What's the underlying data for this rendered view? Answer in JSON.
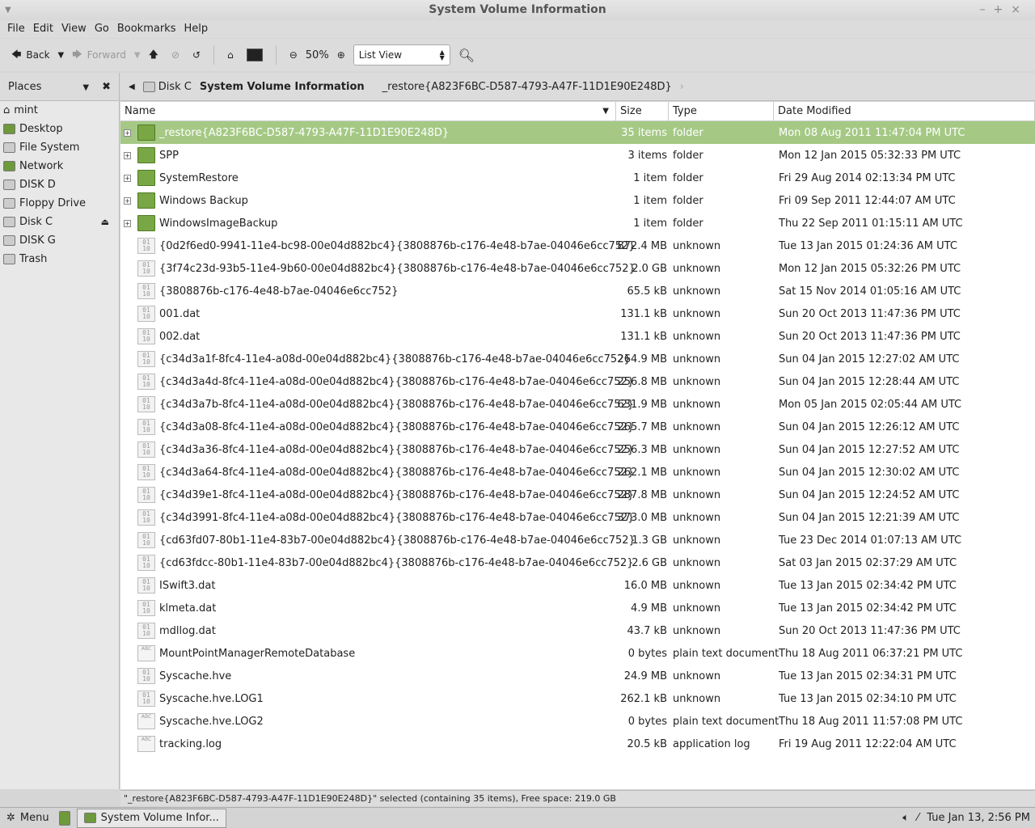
{
  "window": {
    "title": "System Volume Information"
  },
  "menu": [
    "File",
    "Edit",
    "View",
    "Go",
    "Bookmarks",
    "Help"
  ],
  "toolbar": {
    "back": "Back",
    "forward": "Forward",
    "zoom": "50%",
    "view_mode": "List View"
  },
  "sidebar": {
    "title": "Places",
    "items": [
      {
        "label": "mint",
        "icon": "home-icon"
      },
      {
        "label": "Desktop",
        "icon": "desktop-icon"
      },
      {
        "label": "File System",
        "icon": "drive-icon"
      },
      {
        "label": "Network",
        "icon": "network-icon"
      },
      {
        "label": "DISK D",
        "icon": "drive-icon"
      },
      {
        "label": "Floppy Drive",
        "icon": "floppy-icon"
      },
      {
        "label": "Disk C",
        "icon": "drive-icon"
      },
      {
        "label": "DISK G",
        "icon": "drive-icon"
      },
      {
        "label": "Trash",
        "icon": "trash-icon"
      }
    ]
  },
  "path": {
    "disk": "Disk C",
    "current": "System Volume Information",
    "child": "_restore{A823F6BC-D587-4793-A47F-11D1E90E248D}"
  },
  "columns": {
    "name": "Name",
    "size": "Size",
    "type": "Type",
    "date": "Date Modified"
  },
  "files": [
    {
      "name": "_restore{A823F6BC-D587-4793-A47F-11D1E90E248D}",
      "size": "35 items",
      "type": "folder",
      "date": "Mon 08 Aug 2011 11:47:04 PM UTC",
      "kind": "folder",
      "selected": true
    },
    {
      "name": "SPP",
      "size": "3 items",
      "type": "folder",
      "date": "Mon 12 Jan 2015 05:32:33 PM UTC",
      "kind": "folder"
    },
    {
      "name": "SystemRestore",
      "size": "1 item",
      "type": "folder",
      "date": "Fri 29 Aug 2014 02:13:34 PM UTC",
      "kind": "folder"
    },
    {
      "name": "Windows Backup",
      "size": "1 item",
      "type": "folder",
      "date": "Fri 09 Sep 2011 12:44:07 AM UTC",
      "kind": "folder"
    },
    {
      "name": "WindowsImageBackup",
      "size": "1 item",
      "type": "folder",
      "date": "Thu 22 Sep 2011 01:15:11 AM UTC",
      "kind": "folder"
    },
    {
      "name": "{0d2f6ed0-9941-11e4-bc98-00e04d882bc4}{3808876b-c176-4e48-b7ae-04046e6cc752}",
      "size": "872.4 MB",
      "type": "unknown",
      "date": "Tue 13 Jan 2015 01:24:36 AM UTC",
      "kind": "bin"
    },
    {
      "name": "{3f74c23d-93b5-11e4-9b60-00e04d882bc4}{3808876b-c176-4e48-b7ae-04046e6cc752}",
      "size": "2.0 GB",
      "type": "unknown",
      "date": "Mon 12 Jan 2015 05:32:26 PM UTC",
      "kind": "bin"
    },
    {
      "name": "{3808876b-c176-4e48-b7ae-04046e6cc752}",
      "size": "65.5 kB",
      "type": "unknown",
      "date": "Sat 15 Nov 2014 01:05:16 AM UTC",
      "kind": "bin"
    },
    {
      "name": "001.dat",
      "size": "131.1 kB",
      "type": "unknown",
      "date": "Sun 20 Oct 2013 11:47:36 PM UTC",
      "kind": "bin"
    },
    {
      "name": "002.dat",
      "size": "131.1 kB",
      "type": "unknown",
      "date": "Sun 20 Oct 2013 11:47:36 PM UTC",
      "kind": "bin"
    },
    {
      "name": "{c34d3a1f-8fc4-11e4-a08d-00e04d882bc4}{3808876b-c176-4e48-b7ae-04046e6cc752}",
      "size": "264.9 MB",
      "type": "unknown",
      "date": "Sun 04 Jan 2015 12:27:02 AM UTC",
      "kind": "bin"
    },
    {
      "name": "{c34d3a4d-8fc4-11e4-a08d-00e04d882bc4}{3808876b-c176-4e48-b7ae-04046e6cc752}",
      "size": "256.8 MB",
      "type": "unknown",
      "date": "Sun 04 Jan 2015 12:28:44 AM UTC",
      "kind": "bin"
    },
    {
      "name": "{c34d3a7b-8fc4-11e4-a08d-00e04d882bc4}{3808876b-c176-4e48-b7ae-04046e6cc752}",
      "size": "631.9 MB",
      "type": "unknown",
      "date": "Mon 05 Jan 2015 02:05:44 AM UTC",
      "kind": "bin"
    },
    {
      "name": "{c34d3a08-8fc4-11e4-a08d-00e04d882bc4}{3808876b-c176-4e48-b7ae-04046e6cc752}",
      "size": "265.7 MB",
      "type": "unknown",
      "date": "Sun 04 Jan 2015 12:26:12 AM UTC",
      "kind": "bin"
    },
    {
      "name": "{c34d3a36-8fc4-11e4-a08d-00e04d882bc4}{3808876b-c176-4e48-b7ae-04046e6cc752}",
      "size": "256.3 MB",
      "type": "unknown",
      "date": "Sun 04 Jan 2015 12:27:52 AM UTC",
      "kind": "bin"
    },
    {
      "name": "{c34d3a64-8fc4-11e4-a08d-00e04d882bc4}{3808876b-c176-4e48-b7ae-04046e6cc752}",
      "size": "262.1 MB",
      "type": "unknown",
      "date": "Sun 04 Jan 2015 12:30:02 AM UTC",
      "kind": "bin"
    },
    {
      "name": "{c34d39e1-8fc4-11e4-a08d-00e04d882bc4}{3808876b-c176-4e48-b7ae-04046e6cc752}",
      "size": "287.8 MB",
      "type": "unknown",
      "date": "Sun 04 Jan 2015 12:24:52 AM UTC",
      "kind": "bin"
    },
    {
      "name": "{c34d3991-8fc4-11e4-a08d-00e04d882bc4}{3808876b-c176-4e48-b7ae-04046e6cc752}",
      "size": "373.0 MB",
      "type": "unknown",
      "date": "Sun 04 Jan 2015 12:21:39 AM UTC",
      "kind": "bin"
    },
    {
      "name": "{cd63fd07-80b1-11e4-83b7-00e04d882bc4}{3808876b-c176-4e48-b7ae-04046e6cc752}",
      "size": "1.3 GB",
      "type": "unknown",
      "date": "Tue 23 Dec 2014 01:07:13 AM UTC",
      "kind": "bin"
    },
    {
      "name": "{cd63fdcc-80b1-11e4-83b7-00e04d882bc4}{3808876b-c176-4e48-b7ae-04046e6cc752}",
      "size": "2.6 GB",
      "type": "unknown",
      "date": "Sat 03 Jan 2015 02:37:29 AM UTC",
      "kind": "bin"
    },
    {
      "name": "ISwift3.dat",
      "size": "16.0 MB",
      "type": "unknown",
      "date": "Tue 13 Jan 2015 02:34:42 PM UTC",
      "kind": "bin"
    },
    {
      "name": "klmeta.dat",
      "size": "4.9 MB",
      "type": "unknown",
      "date": "Tue 13 Jan 2015 02:34:42 PM UTC",
      "kind": "bin"
    },
    {
      "name": "mdllog.dat",
      "size": "43.7 kB",
      "type": "unknown",
      "date": "Sun 20 Oct 2013 11:47:36 PM UTC",
      "kind": "bin"
    },
    {
      "name": "MountPointManagerRemoteDatabase",
      "size": "0 bytes",
      "type": "plain text document",
      "date": "Thu 18 Aug 2011 06:37:21 PM UTC",
      "kind": "txt"
    },
    {
      "name": "Syscache.hve",
      "size": "24.9 MB",
      "type": "unknown",
      "date": "Tue 13 Jan 2015 02:34:31 PM UTC",
      "kind": "bin"
    },
    {
      "name": "Syscache.hve.LOG1",
      "size": "262.1 kB",
      "type": "unknown",
      "date": "Tue 13 Jan 2015 02:34:10 PM UTC",
      "kind": "bin"
    },
    {
      "name": "Syscache.hve.LOG2",
      "size": "0 bytes",
      "type": "plain text document",
      "date": "Thu 18 Aug 2011 11:57:08 PM UTC",
      "kind": "txt"
    },
    {
      "name": "tracking.log",
      "size": "20.5 kB",
      "type": "application log",
      "date": "Fri 19 Aug 2011 12:22:04 AM UTC",
      "kind": "txt"
    }
  ],
  "status": "\"_restore{A823F6BC-D587-4793-A47F-11D1E90E248D}\" selected (containing 35 items), Free space: 219.0 GB",
  "taskbar": {
    "menu": "Menu",
    "task": "System Volume Infor...",
    "clock": "Tue Jan 13,  2:56 PM"
  },
  "colors": {
    "selection": "#a5c985",
    "folder": "#79a745"
  }
}
